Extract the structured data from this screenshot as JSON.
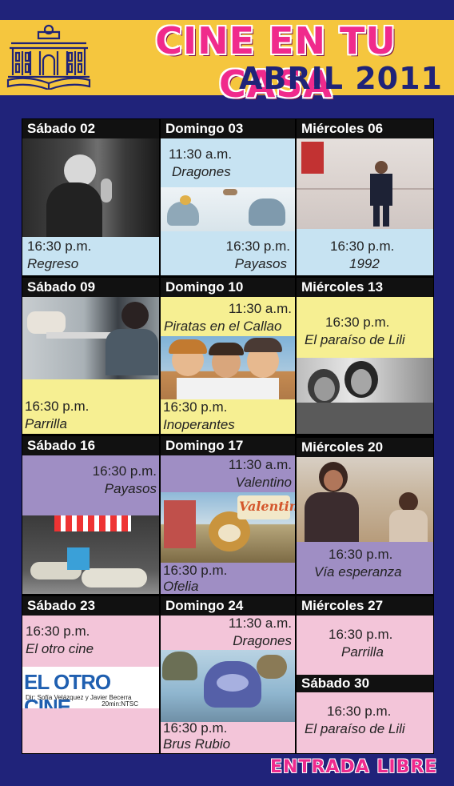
{
  "header": {
    "title": "CINE EN TU CASA",
    "subtitle": "ABRIL 2011"
  },
  "weeks": [
    {
      "c1": {
        "day": "Sábado 02",
        "photo": "boy-with-mask-photo",
        "time": "16:30 p.m.",
        "film": "Regreso"
      },
      "c2": {
        "day": "Domingo 03",
        "time_am": "11:30 a.m.",
        "film_am": "Dragones",
        "photo": "dragons-animation-still",
        "time": "16:30 p.m.",
        "film": "Payasos"
      },
      "c3": {
        "day": "Miércoles 06",
        "photo": "schoolboy-photo",
        "time": "16:30 p.m.",
        "film": "1992"
      }
    },
    {
      "c1": {
        "day": "Sábado 09",
        "photo": "man-at-grill-photo",
        "time": "16:30 p.m.",
        "film": "Parrilla"
      },
      "c2": {
        "day": "Domingo 10",
        "time_am": "11:30 a.m.",
        "film_am": "Piratas en el Callao",
        "photo": "pirates-animation-still",
        "time": "16:30 p.m.",
        "film": "Inoperantes"
      },
      "c3": {
        "day": "Miércoles 13",
        "time": "16:30 p.m.",
        "film": "El paraíso de Lili",
        "photo": "girls-black-white-photo"
      }
    },
    {
      "c1": {
        "day": "Sábado 16",
        "time": "16:30 p.m.",
        "film": "Payasos",
        "photo": "clown-shoes-photo"
      },
      "c2": {
        "day": "Domingo 17",
        "time_am": "11:30 a.m.",
        "film_am": "Valentino",
        "photo": "valentino-dog-animation-still",
        "photo_logo": "Valentino",
        "time": "16:30 p.m.",
        "film": "Ofelia"
      },
      "c3": {
        "day": "Miércoles 20",
        "photo": "woman-and-boy-photo",
        "time": "16:30 p.m.",
        "film": "Vía esperanza"
      }
    },
    {
      "c1": {
        "day": "Sábado 23",
        "time": "16:30 p.m.",
        "film": "El otro cine",
        "card_title": "EL OTRO CINE",
        "card_credits": "Dir: Sofía Velázquez y Javier Becerra",
        "card_length": "20min:NTSC"
      },
      "c2": {
        "day": "Domingo 24",
        "time_am": "11:30 a.m.",
        "film_am": "Dragones",
        "photo": "dragon-animation-still",
        "time": "16:30 p.m.",
        "film": "Brus Rubio"
      },
      "c3": {
        "day": "Miércoles 27",
        "time": "16:30 p.m.",
        "film": "Parrilla",
        "day2": "Sábado 30",
        "time2": "16:30 p.m.",
        "film2": "El paraíso de Lili"
      }
    }
  ],
  "footer": {
    "label": "ENTRADA LIBRE"
  },
  "colors": {
    "background": "#20237a",
    "banner": "#f5c63e",
    "title": "#f02a8c",
    "week1": "#c7e3f2",
    "week2": "#f6ef92",
    "week3": "#9f8ec4",
    "week4": "#f3c5d9"
  },
  "icons": [
    "library-building-logo"
  ]
}
